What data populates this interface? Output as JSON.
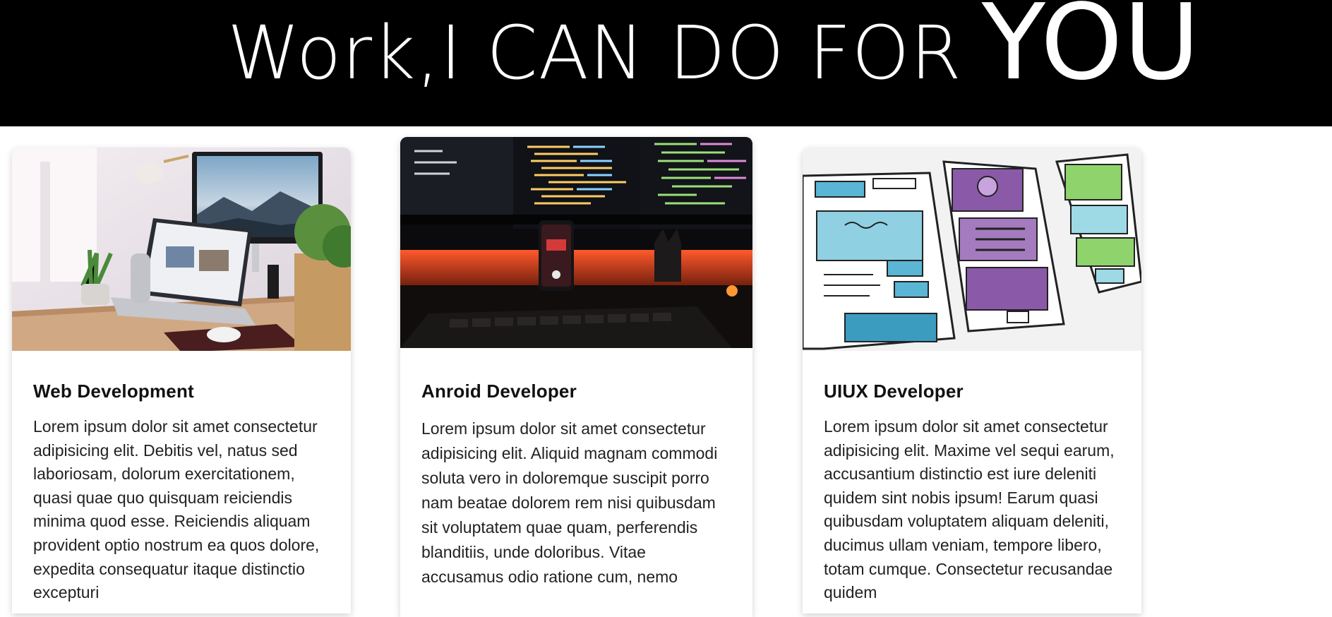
{
  "hero": {
    "title_main": "Work,I CAN DO FOR",
    "title_emphasis": "YOU"
  },
  "cards": [
    {
      "title": "Web Development",
      "image": "desk-workspace-photo",
      "text": "Lorem ipsum dolor sit amet consectetur adipisicing elit. Debitis vel, natus sed laboriosam, dolorum exercitationem, quasi quae quo quisquam reiciendis minima quod esse. Reiciendis aliquam provident optio nostrum ea quos dolore, expedita consequatur itaque distinctio excepturi"
    },
    {
      "title": "Anroid Developer",
      "image": "code-monitors-photo",
      "text": "Lorem ipsum dolor sit amet consectetur adipisicing elit. Aliquid magnam commodi soluta vero in doloremque suscipit porro nam beatae dolorem rem nisi quibusdam sit voluptatem quae quam, perferendis blanditiis, unde doloribus. Vitae accusamus odio ratione cum, nemo"
    },
    {
      "title": "UIUX Developer",
      "image": "wireframe-sketch-photo",
      "text": "Lorem ipsum dolor sit amet consectetur adipisicing elit. Maxime vel sequi earum, accusantium distinctio est iure deleniti quidem sint nobis ipsum! Earum quasi quibusdam voluptatem aliquam deleniti, ducimus ullam veniam, tempore libero, totam cumque. Consectetur recusandae quidem"
    }
  ]
}
